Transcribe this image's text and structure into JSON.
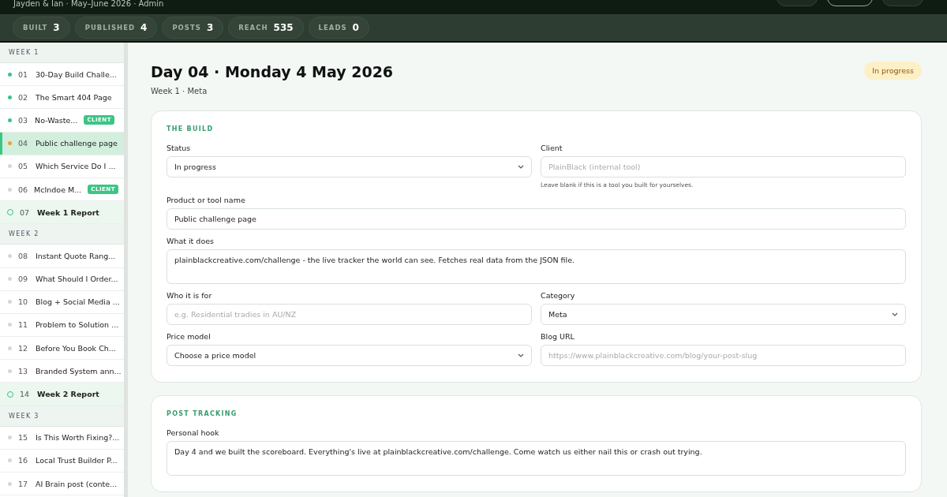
{
  "header": {
    "subtitle": "Jayden & Ian · May–June 2026 · Admin",
    "buttons": [
      {
        "kind": "ghost"
      },
      {
        "kind": "outline"
      },
      {
        "kind": "ghost"
      }
    ]
  },
  "stats": [
    {
      "label": "BUILT",
      "value": "3"
    },
    {
      "label": "PUBLISHED",
      "value": "4"
    },
    {
      "label": "POSTS",
      "value": "3"
    },
    {
      "label": "REACH",
      "value": "535"
    },
    {
      "label": "LEADS",
      "value": "0"
    }
  ],
  "sidebar": [
    {
      "kind": "week",
      "label": "WEEK 1"
    },
    {
      "kind": "day",
      "num": "01",
      "title": "30-Day Build Challe...",
      "color": "#3cc585",
      "selected": false
    },
    {
      "kind": "day",
      "num": "02",
      "title": "The Smart 404 Page",
      "color": "#3cc585",
      "selected": false
    },
    {
      "kind": "day",
      "num": "03",
      "title": "No-Waste...",
      "color": "#3cc585",
      "badge": "CLIENT",
      "selected": false
    },
    {
      "kind": "day",
      "num": "04",
      "title": "Public challenge page",
      "color": "#f0a030",
      "selected": true
    },
    {
      "kind": "day",
      "num": "05",
      "title": "Which Service Do I ...",
      "color": "#d6d8d7",
      "selected": false
    },
    {
      "kind": "day",
      "num": "06",
      "title": "McIndoe M...",
      "color": "#d6d8d7",
      "badge": "CLIENT",
      "selected": false
    },
    {
      "kind": "report",
      "num": "07",
      "title": "Week 1 Report",
      "selected": false
    },
    {
      "kind": "week",
      "label": "WEEK 2"
    },
    {
      "kind": "day",
      "num": "08",
      "title": "Instant Quote Rang...",
      "color": "#d6d8d7",
      "selected": false
    },
    {
      "kind": "day",
      "num": "09",
      "title": "What Should I Order...",
      "color": "#d6d8d7",
      "selected": false
    },
    {
      "kind": "day",
      "num": "10",
      "title": "Blog + Social Media ...",
      "color": "#d6d8d7",
      "selected": false
    },
    {
      "kind": "day",
      "num": "11",
      "title": "Problem to Solution ...",
      "color": "#d6d8d7",
      "selected": false
    },
    {
      "kind": "day",
      "num": "12",
      "title": "Before You Book Ch...",
      "color": "#d6d8d7",
      "selected": false
    },
    {
      "kind": "day",
      "num": "13",
      "title": "Branded System ann...",
      "color": "#d6d8d7",
      "selected": false
    },
    {
      "kind": "report",
      "num": "14",
      "title": "Week 2 Report",
      "selected": false
    },
    {
      "kind": "week",
      "label": "WEEK 3"
    },
    {
      "kind": "day",
      "num": "15",
      "title": "Is This Worth Fixing?...",
      "color": "#d6d8d7",
      "selected": false
    },
    {
      "kind": "day",
      "num": "16",
      "title": "Local Trust Builder P...",
      "color": "#d6d8d7",
      "selected": false
    },
    {
      "kind": "day",
      "num": "17",
      "title": "AI Brain post (conte...",
      "color": "#d6d8d7",
      "selected": false
    }
  ],
  "page": {
    "title": "Day 04 · Monday 4 May 2026",
    "subtitle": "Week 1 · Meta",
    "status_badge": "In progress"
  },
  "sections": [
    {
      "title": "THE BUILD",
      "fields": [
        {
          "kind": "select",
          "label": "Status",
          "value": "In progress"
        },
        {
          "kind": "input",
          "label": "Client",
          "placeholder": "PlainBlack (internal tool)",
          "hint": "Leave blank if this is a tool you built for yourselves."
        },
        {
          "kind": "input",
          "label": "Product or tool name",
          "value": "Public challenge page",
          "wide": true
        },
        {
          "kind": "textarea",
          "label": "What it does",
          "value": "plainblackcreative.com/challenge - the live tracker the world can see. Fetches real data from the JSON file.",
          "wide": true
        },
        {
          "kind": "input",
          "label": "Who it is for",
          "placeholder": "e.g. Residential tradies in AU/NZ"
        },
        {
          "kind": "select",
          "label": "Category",
          "value": "Meta"
        },
        {
          "kind": "select",
          "label": "Price model",
          "value": "Choose a price model"
        },
        {
          "kind": "input",
          "label": "Blog URL",
          "placeholder": "https://www.plainblackcreative.com/blog/your-post-slug"
        }
      ]
    },
    {
      "title": "POST TRACKING",
      "fields": [
        {
          "kind": "textarea",
          "label": "Personal hook",
          "value": "Day 4 and we built the scoreboard. Everything's live at plainblackcreative.com/challenge. Come watch us either nail this or crash out trying.",
          "wide": true
        }
      ]
    }
  ]
}
